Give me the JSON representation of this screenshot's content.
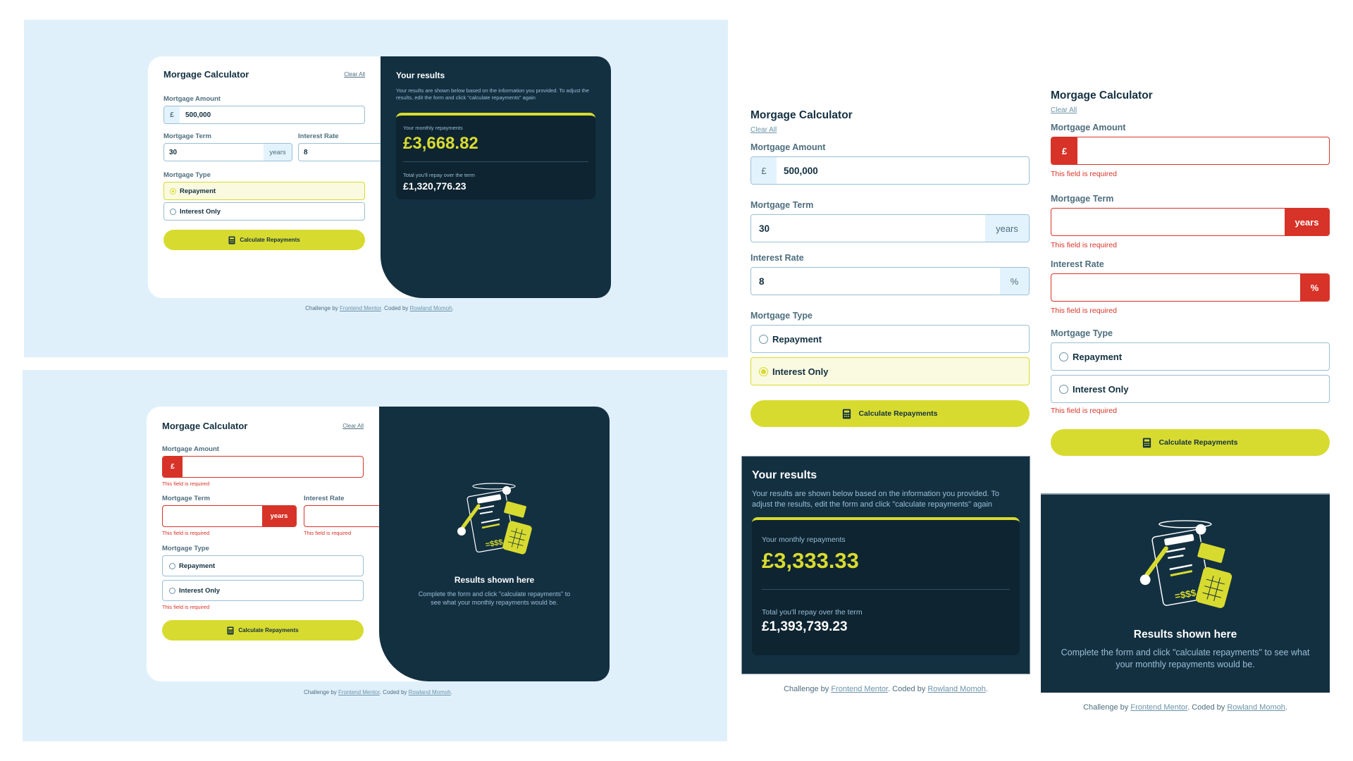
{
  "common": {
    "title": "Morgage Calculator",
    "clear_all": "Clear All",
    "amount_label": "Mortgage Amount",
    "term_label": "Mortgage Term",
    "rate_label": "Interest Rate",
    "type_label": "Mortgage Type",
    "currency_symbol": "£",
    "term_unit": "years",
    "rate_unit": "%",
    "option_repayment": "Repayment",
    "option_interest_only": "Interest Only",
    "calc_button": "Calculate Repayments",
    "error_required": "This field is required",
    "results_title": "Your results",
    "results_desc": "Your results are shown below based on the information you provided. To adjust the results, edit the form and click \"calculate repayments\" again",
    "monthly_label": "Your monthly repayments",
    "total_label": "Total you'll repay over the term",
    "empty_title": "Results shown here",
    "empty_desc": "Complete the form and click \"calculate repayments\" to see what your monthly repayments would be.",
    "footer_prefix": "Challenge by ",
    "footer_link1": "Frontend Mentor",
    "footer_mid": ". Coded by ",
    "footer_link2": "Rowland Momoh",
    "footer_suffix": "."
  },
  "panelA": {
    "amount": "500,000",
    "term": "30",
    "rate": "8",
    "selected_type": "Repayment",
    "monthly": "£3,668.82",
    "total": "£1,320,776.23"
  },
  "panelB": {
    "amount": "",
    "term": "",
    "rate": "",
    "selected_type": ""
  },
  "panelC": {
    "amount": "500,000",
    "term": "30",
    "rate": "8",
    "selected_type": "Interest Only",
    "monthly": "£3,333.33",
    "total": "£1,393,739.23"
  },
  "panelD": {
    "amount": "",
    "term": "",
    "rate": "",
    "selected_type": ""
  },
  "colors": {
    "background": "#e0f0fb",
    "accent_lime": "#d8db2f",
    "dark_slate": "#133041",
    "error_red": "#d73328",
    "selected_bg": "#fafae0"
  }
}
